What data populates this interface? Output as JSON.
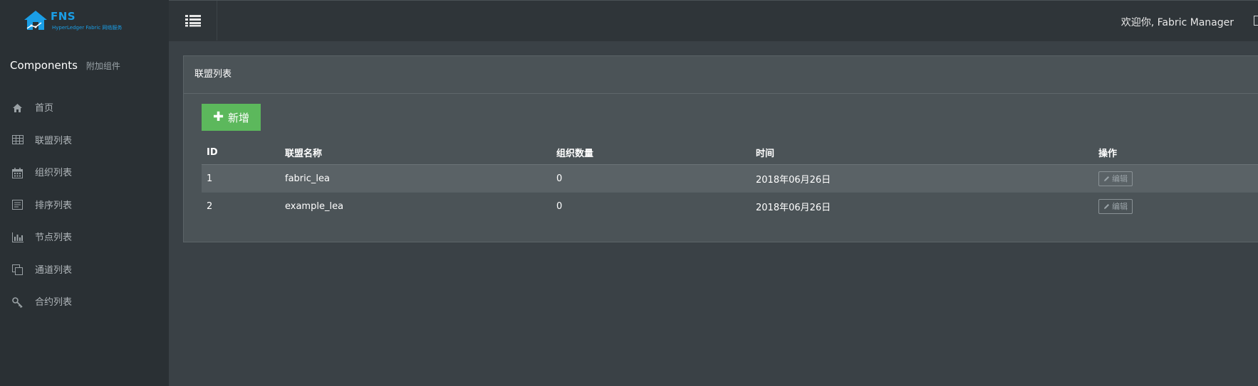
{
  "logo": {
    "title": "FNS",
    "subtitle": "HyperLedger Fabric 网络服务"
  },
  "sidebar": {
    "section_title": "Components",
    "section_sub": "附加组件",
    "items": [
      {
        "label": "首页",
        "icon": "home-icon"
      },
      {
        "label": "联盟列表",
        "icon": "table-icon"
      },
      {
        "label": "组织列表",
        "icon": "calendar-icon"
      },
      {
        "label": "排序列表",
        "icon": "list-box-icon"
      },
      {
        "label": "节点列表",
        "icon": "bar-chart-icon"
      },
      {
        "label": "通道列表",
        "icon": "copy-icon"
      },
      {
        "label": "合约列表",
        "icon": "key-icon"
      }
    ]
  },
  "header": {
    "welcome": "欢迎你, Fabric Manager"
  },
  "panel": {
    "title": "联盟列表",
    "add_label": "新增",
    "columns": [
      "ID",
      "联盟名称",
      "组织数量",
      "时间",
      "操作"
    ],
    "rows": [
      {
        "id": "1",
        "name": "fabric_lea",
        "orgs": "0",
        "time": "2018年06月26日",
        "action": "编辑"
      },
      {
        "id": "2",
        "name": "example_lea",
        "orgs": "0",
        "time": "2018年06月26日",
        "action": "编辑"
      }
    ]
  },
  "colors": {
    "brand": "#1a9ee6",
    "add_button": "#5cb85c",
    "sidebar_bg": "#2a3034",
    "header_bg": "#2f3539",
    "panel_bg": "#4b5357"
  }
}
